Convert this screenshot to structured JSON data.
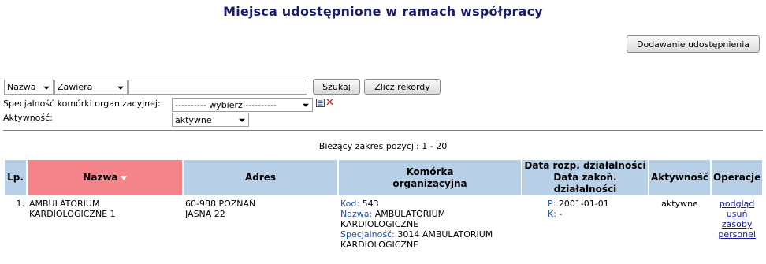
{
  "page": {
    "title": "Miejsca udostępnione w ramach współpracy"
  },
  "toolbar": {
    "add_label": "Dodawanie udostępnienia"
  },
  "filter": {
    "field_select": "Nazwa",
    "operator_select": "Zawiera",
    "search_value": "",
    "search_label": "Szukaj",
    "count_label": "Zlicz rekordy",
    "specialty_label": "Specjalność komórki organizacyjnej:",
    "specialty_value": "---------- wybierz ----------",
    "activity_label": "Aktywność:",
    "activity_value": "aktywne"
  },
  "range_text": "Bieżący zakres pozycji: 1 - 20",
  "table": {
    "headers": {
      "lp": "Lp.",
      "name": "Nazwa",
      "address": "Adres",
      "unit_1": "Komórka",
      "unit_2": "organizacyjna",
      "dates_1": "Data rozp. działalności",
      "dates_2": "Data zakoń. działalności",
      "activity": "Aktywność",
      "operations": "Operacje"
    },
    "rows": [
      {
        "lp": "1.",
        "name_1": "AMBULATORIUM",
        "name_2": "KARDIOLOGICZNE 1",
        "address_1": "60-988 POZNAŃ",
        "address_2": "JASNA 22",
        "code_key": "Kod:",
        "code_val": "543",
        "uname_key": "Nazwa:",
        "uname_val_1": "AMBULATORIUM",
        "uname_val_2": "KARDIOLOGICZNE",
        "spec_key": "Specjalność:",
        "spec_val_1": "3014 AMBULATORIUM",
        "spec_val_2": "KARDIOLOGICZNE",
        "p_key": "P:",
        "p_val": "2001-01-01",
        "k_key": "K:",
        "k_val": "-",
        "activity": "aktywne",
        "op_view": "podgląd",
        "op_delete": "usuń",
        "op_resources_1": "zasoby",
        "op_resources_2": "personel"
      }
    ]
  },
  "icons": [
    "list-icon",
    "clear-icon"
  ],
  "colors": {
    "title": "#1a1a6e",
    "header_bg": "#b8cfe8",
    "sorted_header_bg": "#f4848a",
    "link": "#1a1a8e",
    "key_text": "#2050a0"
  }
}
